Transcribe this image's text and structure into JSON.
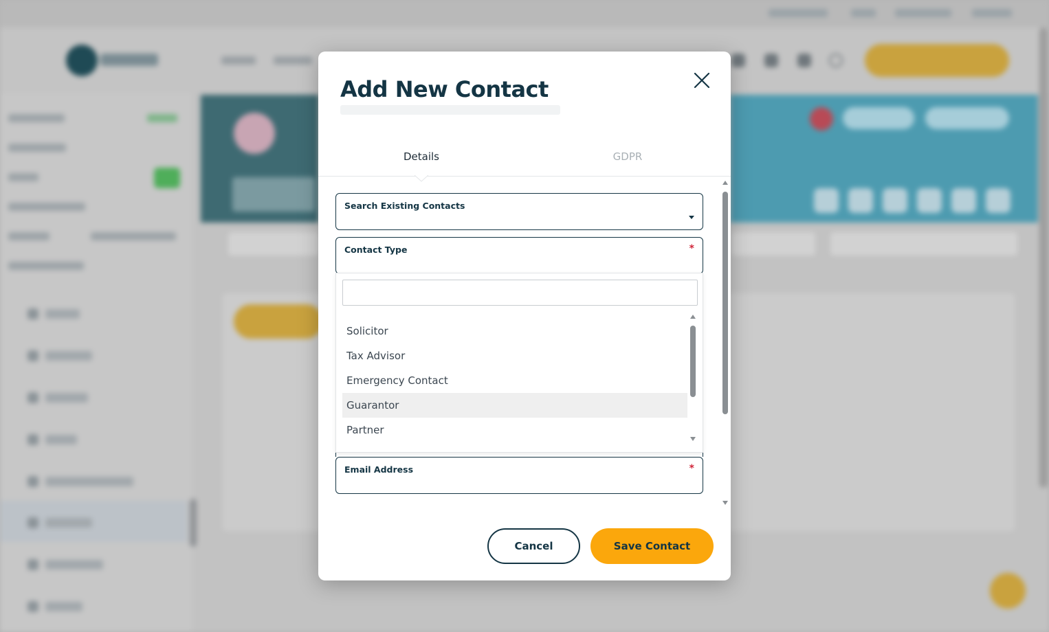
{
  "modal": {
    "title": "Add New Contact",
    "tabs": [
      {
        "label": "Details",
        "active": true
      },
      {
        "label": "GDPR",
        "active": false
      }
    ],
    "fields": {
      "search_contacts": {
        "label": "Search Existing Contacts"
      },
      "contact_type": {
        "label": "Contact Type",
        "required": true
      },
      "email": {
        "label": "Email Address",
        "required": true
      }
    },
    "required_marker": "*",
    "dropdown": {
      "search_value": "",
      "options": [
        "Solicitor",
        "Tax Advisor",
        "Emergency Contact",
        "Guarantor",
        "Partner"
      ],
      "highlighted": "Guarantor"
    },
    "buttons": {
      "cancel": "Cancel",
      "save": "Save Contact"
    },
    "colors": {
      "primary_dark": "#143544",
      "accent": "#fba70c",
      "required": "#d0263a"
    }
  },
  "icons": {
    "close": "close-icon",
    "dropdown": "chevron-down-icon"
  }
}
